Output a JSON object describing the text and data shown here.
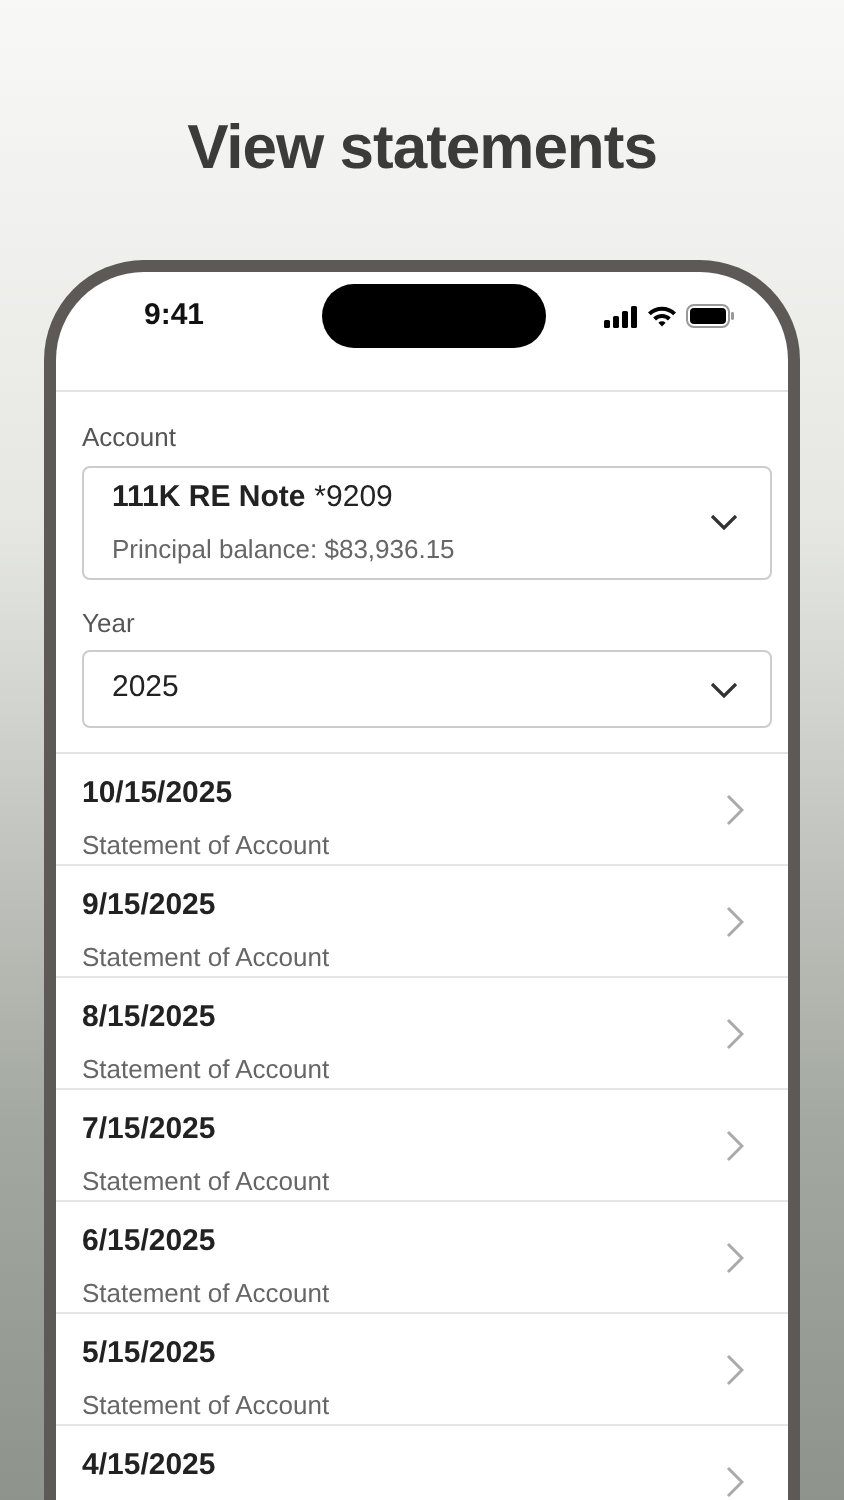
{
  "headline": "View statements",
  "status_bar": {
    "time": "9:41"
  },
  "account_field": {
    "label": "Account",
    "name": "111K RE Note",
    "number": "*9209",
    "detail": "Principal balance: $83,936.15"
  },
  "year_field": {
    "label": "Year",
    "value": "2025"
  },
  "statements": [
    {
      "date": "10/15/2025",
      "title": "Statement of Account"
    },
    {
      "date": "9/15/2025",
      "title": "Statement of Account"
    },
    {
      "date": "8/15/2025",
      "title": "Statement of Account"
    },
    {
      "date": "7/15/2025",
      "title": "Statement of Account"
    },
    {
      "date": "6/15/2025",
      "title": "Statement of Account"
    },
    {
      "date": "5/15/2025",
      "title": "Statement of Account"
    },
    {
      "date": "4/15/2025"
    }
  ]
}
